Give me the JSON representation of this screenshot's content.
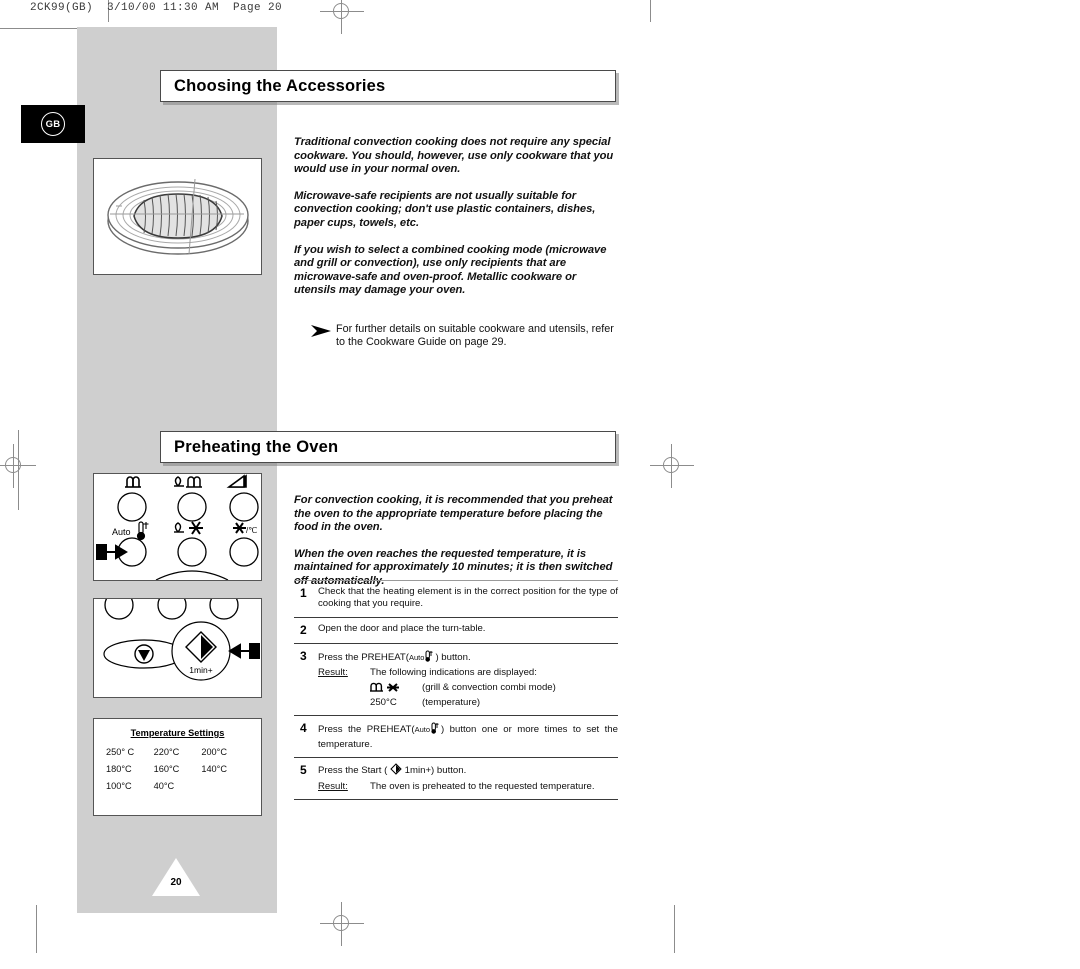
{
  "prepress": {
    "header_text": "2CK99(GB)  3/10/00 11:30 AM  Page 20"
  },
  "locale_tab": {
    "label": "GB"
  },
  "sections": [
    {
      "id": "accessories",
      "title": "Choosing the Accessories"
    },
    {
      "id": "preheating",
      "title": "Preheating the Oven"
    }
  ],
  "accessories": {
    "paragraphs": [
      "Traditional convection cooking does not require any special cookware. You should, however, use only cookware that you would use in your normal oven.",
      "Microwave-safe recipients are not usually suitable for convection cooking; don't use plastic containers, dishes, paper cups, towels, etc.",
      "If you wish to select a combined cooking mode (microwave and grill or convection), use only recipients that are microwave-safe and oven-proof. Metallic cookware or utensils may damage your oven."
    ],
    "note": "For further details on suitable cookware and utensils, refer to the Cookware Guide on page 29."
  },
  "preheating": {
    "paragraphs": [
      "For convection cooking, it is recommended that you preheat the oven to the appropriate temperature before placing the food in the oven.",
      "When the oven reaches the requested temperature, it is maintained for approximately 10 minutes; it is then switched off automatically."
    ],
    "steps": [
      {
        "number": "1",
        "text": "Check that the heating element is in the correct position for the type of cooking that you require."
      },
      {
        "number": "2",
        "text": "Open the door and place the turn-table."
      },
      {
        "number": "3",
        "text_before": "Press the PREHEAT(",
        "text_after": ") button.",
        "result_label": "Result:",
        "result_text": "The following indications are displayed:",
        "sub_rows": [
          {
            "code": "",
            "desc": "(grill & convection combi mode)"
          },
          {
            "code": "250°C",
            "desc": "(temperature)"
          }
        ]
      },
      {
        "number": "4",
        "text_before": "Press the PREHEAT(",
        "text_after": ") button one or more times to set the temperature."
      },
      {
        "number": "5",
        "text_before": "Press the  Start ( ",
        "text_mid": "1min+) button.",
        "result_label": "Result:",
        "result_text": "The oven is preheated to the requested temperature."
      }
    ]
  },
  "temperature_settings": {
    "title": "Temperature Settings",
    "values": [
      "250° C",
      "220°C",
      "200°C",
      "180°C",
      "160°C",
      "140°C",
      "100°C",
      "40°C"
    ]
  },
  "control_panel_top": {
    "auto_label": "Auto",
    "combi_label": ""
  },
  "control_panel_bottom": {
    "start_label": "1min+"
  },
  "page_number": "20"
}
